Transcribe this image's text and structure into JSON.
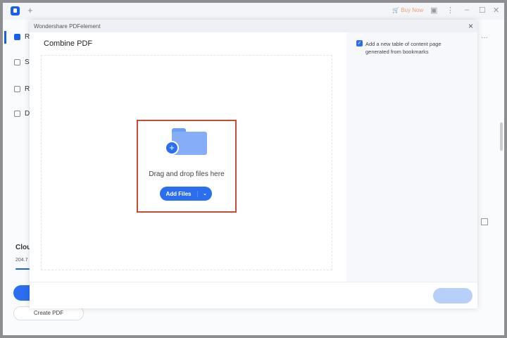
{
  "topbar": {
    "buy_now": "Buy Now"
  },
  "sidebar": {
    "items": [
      {
        "label": "R"
      },
      {
        "label": "S"
      },
      {
        "label": "R"
      },
      {
        "label": "D"
      }
    ],
    "cloud_label": "Clou",
    "storage": "204.7",
    "create_pdf": "Create PDF"
  },
  "dialog": {
    "window_title": "Wondershare PDFelement",
    "heading": "Combine PDF",
    "drop_text": "Drag and drop files here",
    "add_files": "Add Files",
    "toc_option": {
      "label": "Add a new table of content page generated from bookmarks",
      "checked": true
    }
  },
  "colors": {
    "accent": "#2b6ff0",
    "highlight_border": "#c94a3a"
  }
}
